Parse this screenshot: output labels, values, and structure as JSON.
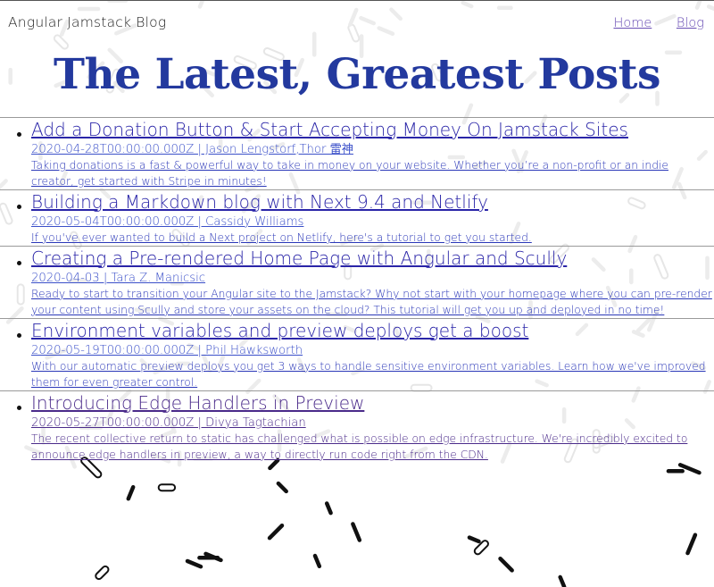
{
  "header": {
    "brand": "Angular Jamstack Blog",
    "nav": [
      {
        "label": "Home"
      },
      {
        "label": "Blog"
      }
    ]
  },
  "page_title": "The Latest, Greatest Posts",
  "posts": [
    {
      "title": "Add a Donation Button & Start Accepting Money On Jamstack Sites",
      "meta": "2020-04-28T00:00:00.000Z | Jason Lengstorf,Thor 雷神",
      "description": "Taking donations is a fast & powerful way to take in money on your website. Whether you’re a non-profit or an indie creator, get started with Stripe in minutes!"
    },
    {
      "title": "Building a Markdown blog with Next 9.4 and Netlify",
      "meta": "2020-05-04T00:00:00.000Z | Cassidy Williams",
      "description": "If you've ever wanted to build a Next project on Netlify, here's a tutorial to get you started."
    },
    {
      "title": "Creating a Pre-rendered Home Page with Angular and Scully",
      "meta": "2020-04-03 | Tara Z. Manicsic",
      "description": "Ready to start to transition your Angular site to the Jamstack? Why not start with your homepage where you can pre-render your content using Scully and store your assets on the cloud? This tutorial will get you up and deployed in no time!"
    },
    {
      "title": "Environment variables and preview deploys get a boost",
      "meta": "2020-05-19T00:00:00.000Z | Phil Hawksworth",
      "description": "With our automatic preview deploys you get 3 ways to handle sensitive environment variables. Learn how we've improved them for even greater control."
    },
    {
      "title": "Introducing Edge Handlers in Preview",
      "meta": "2020-05-27T00:00:00.000Z | Divya Tagtachian",
      "description": "The recent collective return to static has challenged what is possible on edge infrastructure. We're incredibly excited to announce edge handlers in preview, a way to directly run code right from the CDN."
    }
  ],
  "colors": {
    "heading": "#23399e",
    "link": "#2a25a8",
    "visited": "#4a2a8a",
    "confetti": "#111111"
  }
}
